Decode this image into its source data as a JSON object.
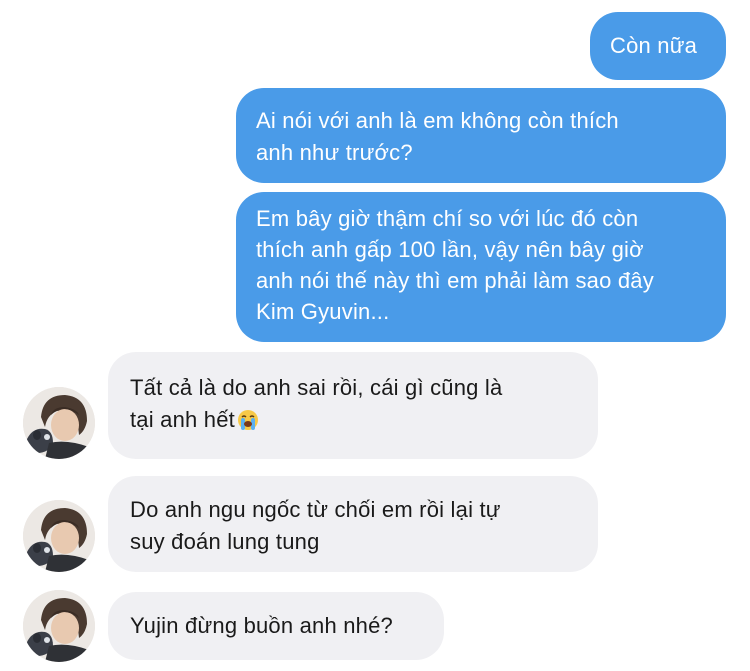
{
  "conversation": {
    "messages": [
      {
        "direction": "sent",
        "text": "Còn nữa"
      },
      {
        "direction": "sent",
        "text": "Ai nói với anh là em không còn thích\nanh như trước?"
      },
      {
        "direction": "sent",
        "text": "Em bây giờ thậm chí so với lúc đó còn\nthích anh gấp 100 lần, vậy nên bây giờ\nanh nói thế này thì em phải làm sao đây\nKim Gyuvin..."
      },
      {
        "direction": "received",
        "text": "Tất cả là do anh sai rồi, cái gì cũng là\ntại anh hết",
        "emoji": "loudly-crying-face"
      },
      {
        "direction": "received",
        "text": "Do anh ngu ngốc từ chối em rồi lại tự\nsuy đoán lung tung"
      },
      {
        "direction": "received",
        "text": "Yujin đừng buồn anh nhé?"
      }
    ]
  },
  "colors": {
    "sent_bubble": "#4a9be8",
    "sent_text": "#ffffff",
    "received_bubble": "#f0f0f3",
    "received_text": "#1a1a1a",
    "background": "#ffffff"
  }
}
